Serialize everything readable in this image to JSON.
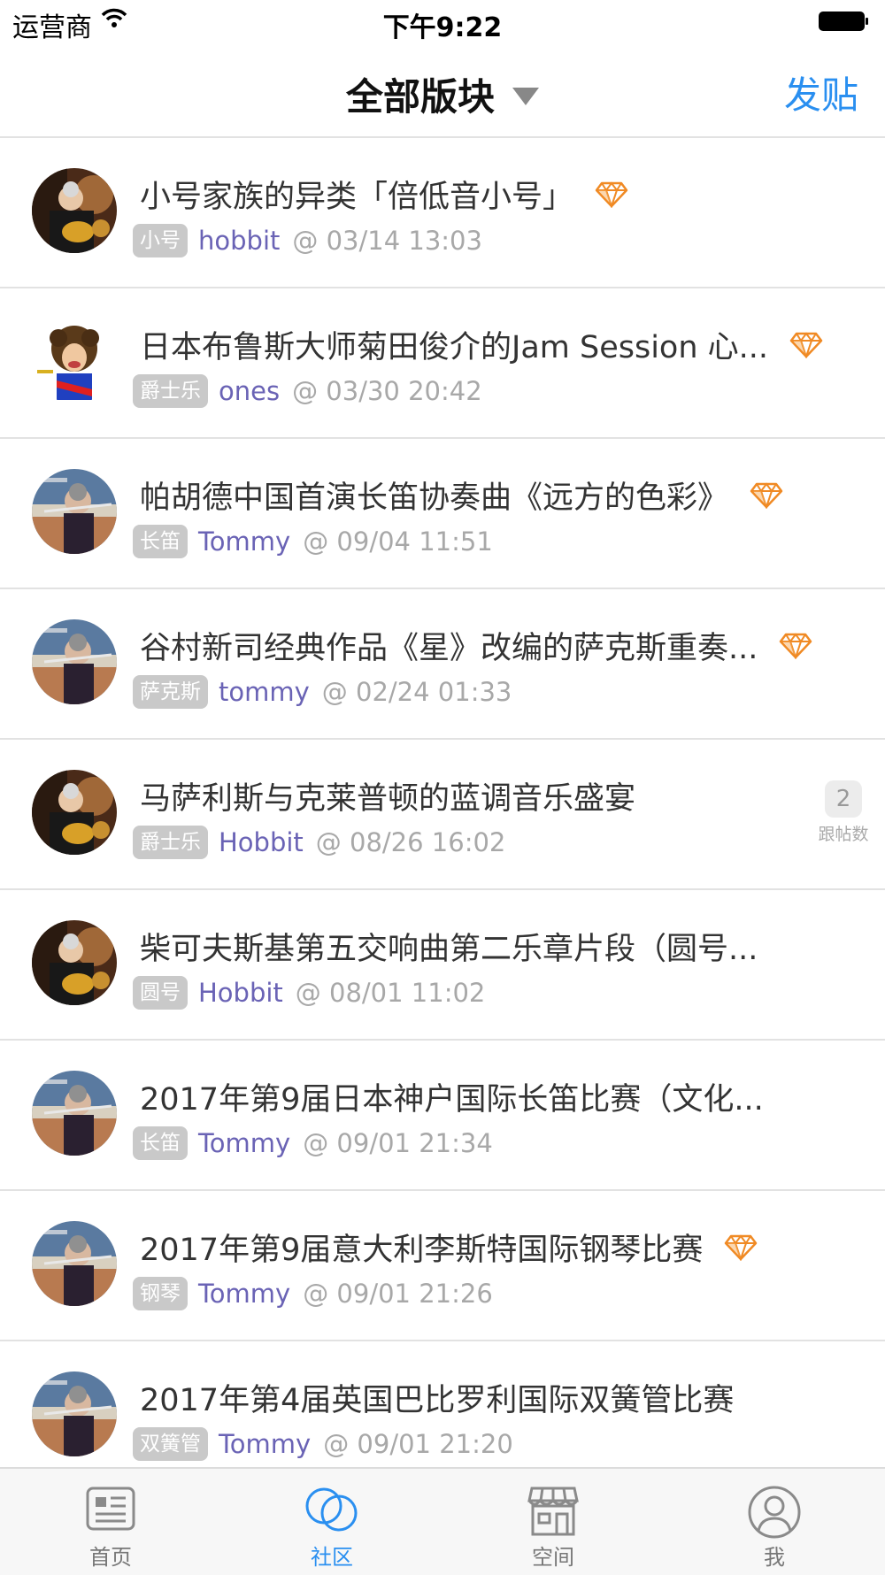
{
  "status_bar": {
    "carrier": "运营商",
    "time": "下午9:22"
  },
  "navbar": {
    "title": "全部版块",
    "post_label": "发贴"
  },
  "posts": [
    {
      "title": "小号家族的异类「倍低音小号」",
      "tag": "小号",
      "user": "hobbit",
      "date": "@ 03/14 13:03",
      "gem": true,
      "avatar": "trumpet-player"
    },
    {
      "title": "日本布鲁斯大师菊田俊介的Jam Session 心...",
      "tag": "爵士乐",
      "user": "ones",
      "date": "@ 03/30 20:42",
      "gem": true,
      "avatar": "cartoon-guitarist"
    },
    {
      "title": "帕胡德中国首演长笛协奏曲《远方的色彩》",
      "tag": "长笛",
      "user": "Tommy",
      "date": "@ 09/04 11:51",
      "gem": true,
      "avatar": "flutist"
    },
    {
      "title": "谷村新司经典作品《星》改编的萨克斯重奏...",
      "tag": "萨克斯",
      "user": "tommy",
      "date": "@ 02/24 01:33",
      "gem": true,
      "avatar": "flutist"
    },
    {
      "title": "马萨利斯与克莱普顿的蓝调音乐盛宴",
      "tag": "爵士乐",
      "user": "Hobbit",
      "date": "@ 08/26 16:02",
      "gem": false,
      "reply_count": "2",
      "reply_label": "跟帖数",
      "avatar": "trumpet-player"
    },
    {
      "title": "柴可夫斯基第五交响曲第二乐章片段（圆号...",
      "tag": "圆号",
      "user": "Hobbit",
      "date": "@ 08/01 11:02",
      "gem": false,
      "avatar": "trumpet-player"
    },
    {
      "title": "2017年第9届日本神户国际长笛比赛（文化...",
      "tag": "长笛",
      "user": "Tommy",
      "date": "@ 09/01 21:34",
      "gem": false,
      "avatar": "flutist"
    },
    {
      "title": "2017年第9届意大利李斯特国际钢琴比赛",
      "tag": "钢琴",
      "user": "Tommy",
      "date": "@ 09/01 21:26",
      "gem": true,
      "avatar": "flutist"
    },
    {
      "title": "2017年第4届英国巴比罗利国际双簧管比赛",
      "tag": "双簧管",
      "user": "Tommy",
      "date": "@ 09/01 21:20",
      "gem": false,
      "avatar": "flutist"
    }
  ],
  "tabbar": {
    "items": [
      {
        "label": "首页",
        "icon": "home-news-icon"
      },
      {
        "label": "社区",
        "icon": "community-circles-icon",
        "active": true
      },
      {
        "label": "空间",
        "icon": "store-space-icon"
      },
      {
        "label": "我",
        "icon": "user-profile-icon"
      }
    ]
  },
  "colors": {
    "accent": "#2a8ff0",
    "username": "#6a63b5",
    "gem": "#f08a24",
    "tag_bg": "#c9c9c9"
  }
}
